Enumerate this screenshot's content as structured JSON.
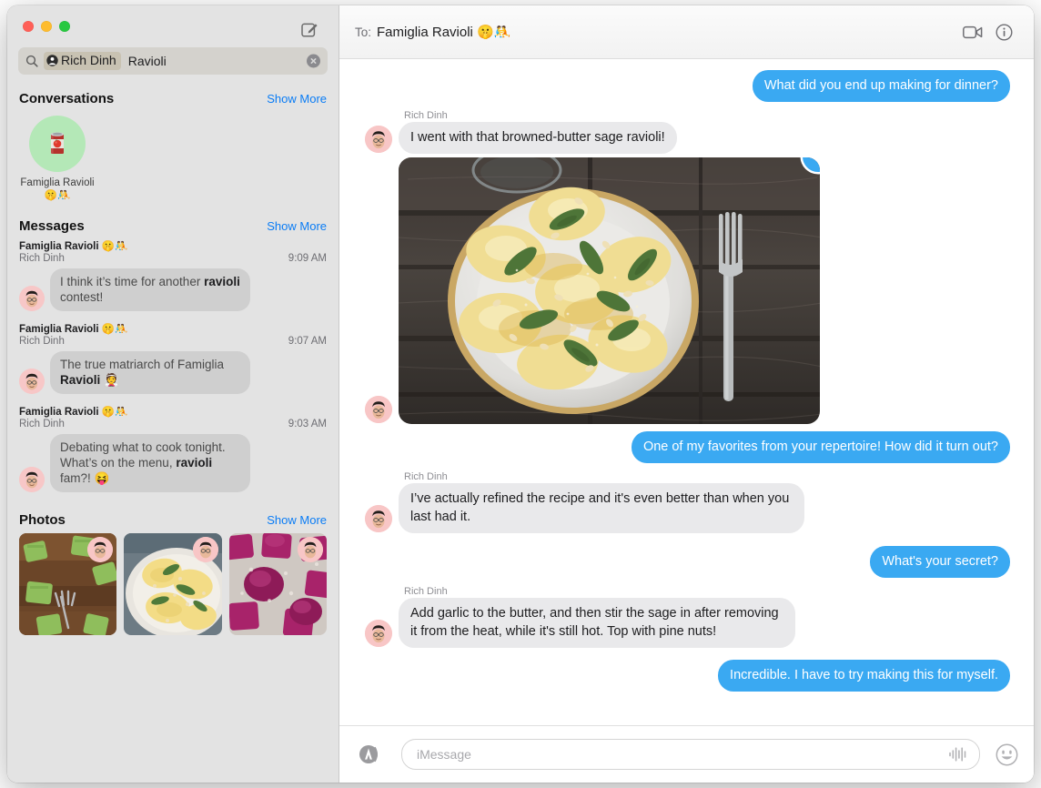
{
  "window": {
    "traffic_lights": [
      "close",
      "minimize",
      "zoom"
    ],
    "compose_icon": "compose-icon"
  },
  "sidebar": {
    "search": {
      "icon": "search-icon",
      "token_label": "Rich Dinh",
      "token_icon": "person-icon",
      "query_text": "Ravioli",
      "placeholder": "Search",
      "clear_icon": "clear-icon"
    },
    "sections": {
      "conversations": {
        "title": "Conversations",
        "show_more": "Show More",
        "items": [
          {
            "avatar_emoji": "🥫",
            "name": "Famiglia Ravioli 🤫🤼"
          }
        ]
      },
      "messages": {
        "title": "Messages",
        "show_more": "Show More",
        "items": [
          {
            "chat": "Famiglia Ravioli 🤫🤼",
            "sender": "Rich Dinh",
            "time": "9:09 AM",
            "text_pre": "I think it’s time for another ",
            "text_match": "ravioli",
            "text_post": " contest!"
          },
          {
            "chat": "Famiglia Ravioli 🤫🤼",
            "sender": "Rich Dinh",
            "time": "9:07 AM",
            "text_pre": "The true matriarch of Famiglia ",
            "text_match": "Ravioli",
            "text_post": " 👰"
          },
          {
            "chat": "Famiglia Ravioli 🤫🤼",
            "sender": "Rich Dinh",
            "time": "9:03 AM",
            "text_pre": "Debating what to cook tonight. What’s on the menu, ",
            "text_match": "ravioli",
            "text_post": " fam?! 😝"
          }
        ]
      },
      "photos": {
        "title": "Photos",
        "show_more": "Show More",
        "items": [
          {
            "description": "green-spinach-ravioli-on-wood-with-fork"
          },
          {
            "description": "yellow-ravioli-with-sage-on-plate"
          },
          {
            "description": "magenta-beet-ravioli-on-floured-surface"
          }
        ]
      }
    }
  },
  "conversation": {
    "header": {
      "to_label": "To:",
      "recipient": "Famiglia Ravioli 🤫🤼",
      "facetime_icon": "video-camera-icon",
      "info_icon": "info-icon"
    },
    "messages": [
      {
        "type": "text",
        "direction": "out",
        "text": "What did you end up making for dinner?"
      },
      {
        "type": "text",
        "direction": "in",
        "sender": "Rich Dinh",
        "text": "I went with that browned-butter sage ravioli!"
      },
      {
        "type": "image",
        "direction": "in",
        "description": "plated-browned-butter-sage-ravioli-with-pine-nuts",
        "reaction": "heart"
      },
      {
        "type": "text",
        "direction": "out",
        "text": "One of my favorites from your repertoire! How did it turn out?"
      },
      {
        "type": "text",
        "direction": "in",
        "sender": "Rich Dinh",
        "text": "I’ve actually refined the recipe and it's even better than when you last had it."
      },
      {
        "type": "text",
        "direction": "out",
        "text": "What's your secret?"
      },
      {
        "type": "text",
        "direction": "in",
        "sender": "Rich Dinh",
        "text": "Add garlic to the butter, and then stir the sage in after removing it from the heat, while it's still hot. Top with pine nuts!"
      },
      {
        "type": "text",
        "direction": "out",
        "text": "Incredible. I have to try making this for myself."
      }
    ],
    "composer": {
      "apps_icon": "app-store-icon",
      "placeholder": "iMessage",
      "value": "",
      "audio_icon": "audio-waveform-icon",
      "emoji_icon": "emoji-smiley-icon"
    }
  },
  "colors": {
    "bubble_out": "#3aa9f2",
    "bubble_in": "#e9e9eb",
    "accent_link": "#0a7cf5",
    "sidebar_bg": "#e3e3e3",
    "reaction": "#3aa9f2"
  }
}
